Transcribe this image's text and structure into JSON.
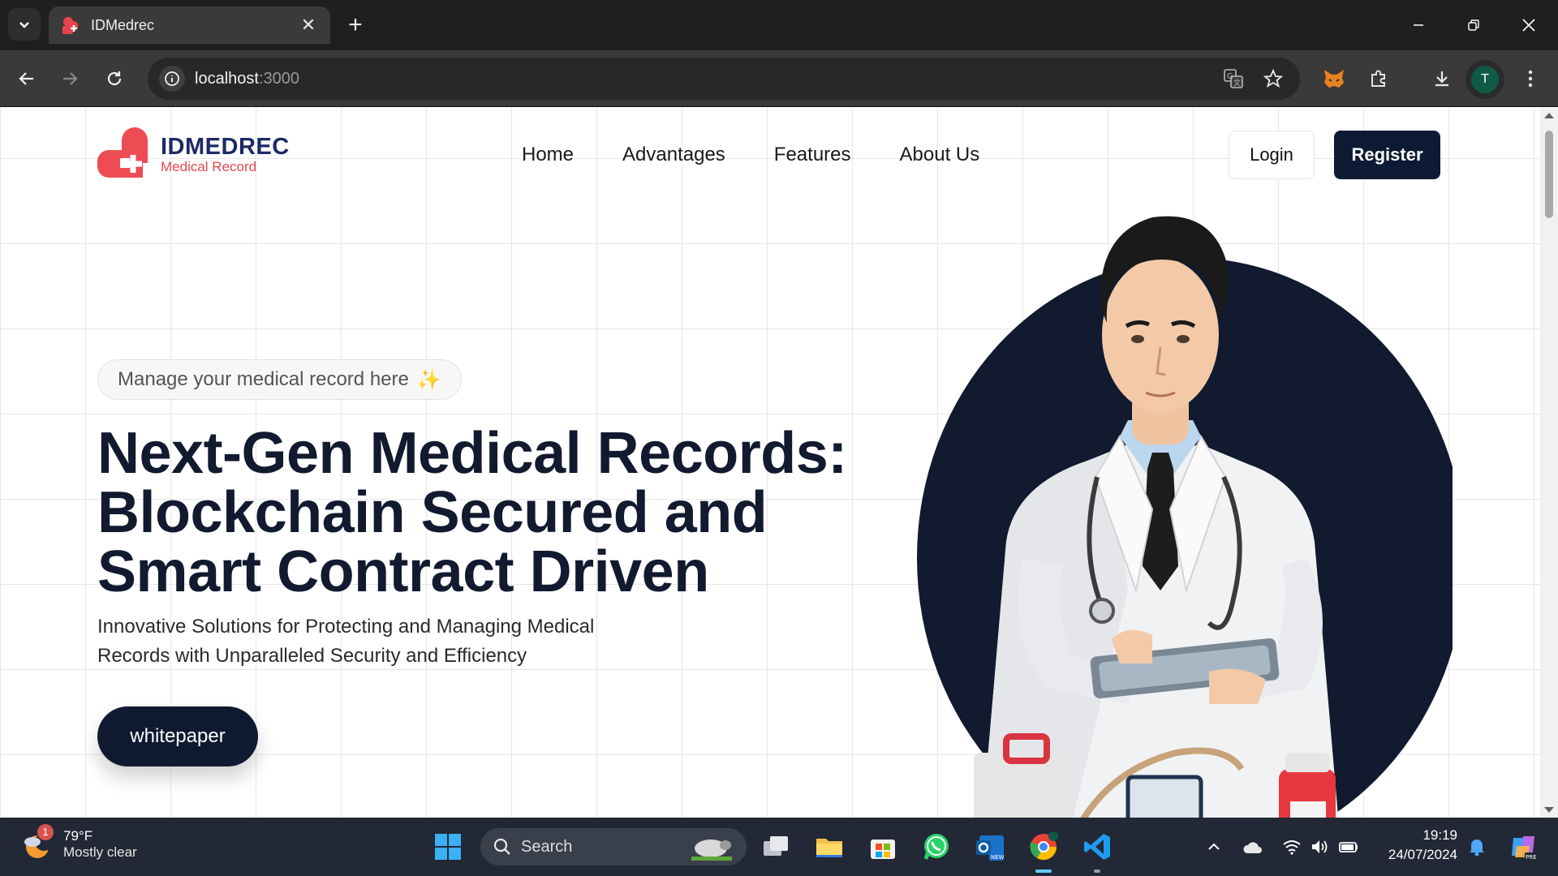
{
  "browser": {
    "tab_title": "IDMedrec",
    "url_host": "localhost",
    "url_port": ":3000",
    "profile_initial": "T"
  },
  "site": {
    "logo_name": "IDMEDREC",
    "logo_sub": "Medical Record",
    "nav": [
      "Home",
      "Advantages",
      "Features",
      "About Us"
    ],
    "login_label": "Login",
    "register_label": "Register"
  },
  "hero": {
    "pill_text": "Manage your medical record here",
    "title_lines": [
      "Next-Gen Medical Records:",
      "Blockchain Secured and",
      "Smart Contract Driven"
    ],
    "subtitle_lines": [
      "Innovative Solutions for Protecting and Managing Medical",
      "Records with Unparalleled Security and Efficiency"
    ],
    "cta_label": "whitepaper"
  },
  "taskbar": {
    "weather_temp": "79°F",
    "weather_desc": "Mostly clear",
    "weather_badge": "1",
    "search_label": "Search",
    "time": "19:19",
    "date": "24/07/2024"
  },
  "colors": {
    "brand_navy": "#1d2a66",
    "brand_red": "#e54750",
    "dark_button": "#0d1a33"
  }
}
